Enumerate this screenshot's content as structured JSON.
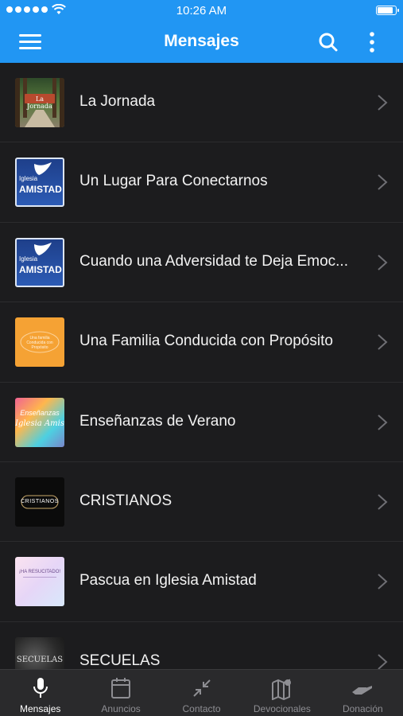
{
  "status_bar": {
    "time": "10:26 AM",
    "battery_level": 0.9
  },
  "nav": {
    "title": "Mensajes"
  },
  "list": {
    "items": [
      {
        "label": "La Jornada",
        "thumb": {
          "text": "La Jornada",
          "icon": "forest-road-image"
        }
      },
      {
        "label": "Un Lugar Para Conectarnos",
        "thumb": {
          "text_top": "Iglesia",
          "text_main": "AMISTAD",
          "icon": "dove-logo"
        }
      },
      {
        "label": "Cuando una Adversidad te Deja Emoc...",
        "thumb": {
          "text_top": "Iglesia",
          "text_main": "AMISTAD",
          "icon": "dove-logo"
        }
      },
      {
        "label": "Una Familia Conducida con Propósito",
        "thumb": {
          "text_top": "Una familia",
          "text_main": "Conducida con Propósito",
          "icon": "orange-badge"
        }
      },
      {
        "label": "Enseñanzas de Verano",
        "thumb": {
          "text_top": "Enseñanzas",
          "text_main": "Iglesia Amistad",
          "icon": "watercolor-image"
        }
      },
      {
        "label": "CRISTIANOS",
        "thumb": {
          "text_main": "CRISTIANOS",
          "icon": "dark-badge"
        }
      },
      {
        "label": "Pascua en Iglesia Amistad",
        "thumb": {
          "text_main": "¡HA RESUCITADO!",
          "icon": "pastel-image"
        }
      },
      {
        "label": "SECUELAS",
        "thumb": {
          "text_main": "SECUELAS",
          "icon": "smoke-image"
        }
      }
    ]
  },
  "tabbar": {
    "tabs": [
      {
        "label": "Mensajes",
        "icon": "microphone-icon",
        "active": true
      },
      {
        "label": "Anuncios",
        "icon": "calendar-icon",
        "active": false
      },
      {
        "label": "Contacto",
        "icon": "compress-arrows-icon",
        "active": false
      },
      {
        "label": "Devocionales",
        "icon": "map-pin-icon",
        "active": false
      },
      {
        "label": "Donación",
        "icon": "giving-hand-icon",
        "active": false
      }
    ]
  },
  "colors": {
    "accent": "#2196f3",
    "background": "#1c1c1e",
    "tabbar": "#2a2a2c"
  }
}
